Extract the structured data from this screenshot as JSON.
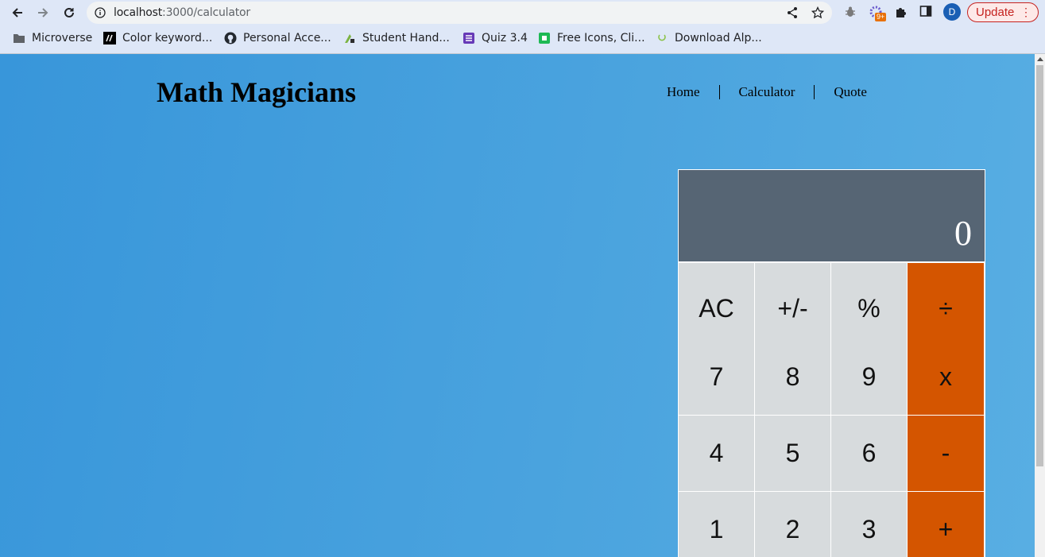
{
  "browser": {
    "url_host": "localhost",
    "url_rest": ":3000/calculator",
    "avatar_letter": "D",
    "update_label": "Update",
    "extension_badge": "9+"
  },
  "bookmarks": [
    {
      "label": "Microverse",
      "icon": "folder-icon"
    },
    {
      "label": "Color keyword...",
      "icon": "mdn-icon"
    },
    {
      "label": "Personal Acce...",
      "icon": "github-icon"
    },
    {
      "label": "Student Hand...",
      "icon": "notion-icon"
    },
    {
      "label": "Quiz 3.4",
      "icon": "form-icon"
    },
    {
      "label": "Free Icons, Cli...",
      "icon": "icons-icon"
    },
    {
      "label": "Download Alp...",
      "icon": "alpine-icon"
    }
  ],
  "page": {
    "logo": "Math Magicians",
    "nav": [
      "Home",
      "Calculator",
      "Quote"
    ]
  },
  "calculator": {
    "display": "0",
    "keys": [
      [
        "AC",
        "+/-",
        "%",
        "÷"
      ],
      [
        "7",
        "8",
        "9",
        "x"
      ],
      [
        "4",
        "5",
        "6",
        "-"
      ],
      [
        "1",
        "2",
        "3",
        "+"
      ]
    ],
    "operator_color": "#d45500",
    "key_color": "#d7dbdd",
    "display_color": "#566574"
  },
  "colors": {
    "background": "#4aa3de"
  }
}
